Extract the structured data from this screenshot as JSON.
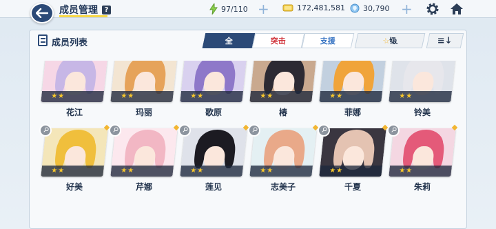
{
  "header": {
    "title": "成员管理",
    "help_label": "?",
    "ap": "97/110",
    "credits": "172,481,581",
    "gems": "30,790"
  },
  "panel": {
    "title": "成员列表",
    "tabs": [
      "全",
      "突击",
      "支援"
    ],
    "sort_label": "级",
    "order_label": "≡↓"
  },
  "colors": {
    "accent": "#2c4a77",
    "striker": "#d0333a",
    "support": "#3a76c4",
    "star": "#f6c62c"
  },
  "members": [
    {
      "name": "花江",
      "stars": "★★",
      "hair": "#c7b7e6",
      "bg": "#f6d7e6",
      "pinned": false
    },
    {
      "name": "玛丽",
      "stars": "★★",
      "hair": "#e6a35a",
      "bg": "#f3e5d2",
      "pinned": false
    },
    {
      "name": "歌原",
      "stars": "★★",
      "hair": "#8e78c9",
      "bg": "#d9d1ef",
      "pinned": false
    },
    {
      "name": "椿",
      "stars": "★★",
      "hair": "#2c2a33",
      "bg": "#c9a98f",
      "pinned": false
    },
    {
      "name": "菲娜",
      "stars": "★★",
      "hair": "#f0a43a",
      "bg": "#c2d0df",
      "pinned": false
    },
    {
      "name": "铃美",
      "stars": "★★",
      "hair": "#e7e7ec",
      "bg": "#dfe3ea",
      "pinned": false
    },
    {
      "name": "好美",
      "stars": "★★",
      "hair": "#f0bf3c",
      "bg": "#f4e6b9",
      "pinned": true
    },
    {
      "name": "芹娜",
      "stars": "★★",
      "hair": "#f2b7c4",
      "bg": "#fce8ee",
      "pinned": true
    },
    {
      "name": "莲见",
      "stars": "★★",
      "hair": "#1c1b22",
      "bg": "#dfe2ea",
      "pinned": true
    },
    {
      "name": "志美子",
      "stars": "★★",
      "hair": "#e9a989",
      "bg": "#e4f0f3",
      "pinned": true
    },
    {
      "name": "千夏",
      "stars": "★★",
      "hair": "#e4c3b2",
      "bg": "#3a3640",
      "pinned": true
    },
    {
      "name": "朱莉",
      "stars": "★★",
      "hair": "#e45a79",
      "bg": "#f4d7e2",
      "pinned": true
    }
  ]
}
